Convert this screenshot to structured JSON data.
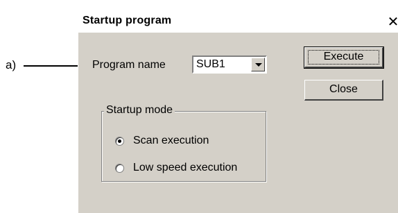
{
  "callout": {
    "label": "a)"
  },
  "dialog": {
    "title": "Startup program",
    "close_glyph": "✕",
    "program_name_label": "Program name",
    "program_name_value": "SUB1",
    "execute_label": "Execute",
    "close_label": "Close",
    "startup_mode": {
      "title": "Startup mode",
      "options": [
        {
          "label": "Scan execution",
          "selected": true
        },
        {
          "label": "Low speed execution",
          "selected": false
        }
      ]
    }
  }
}
